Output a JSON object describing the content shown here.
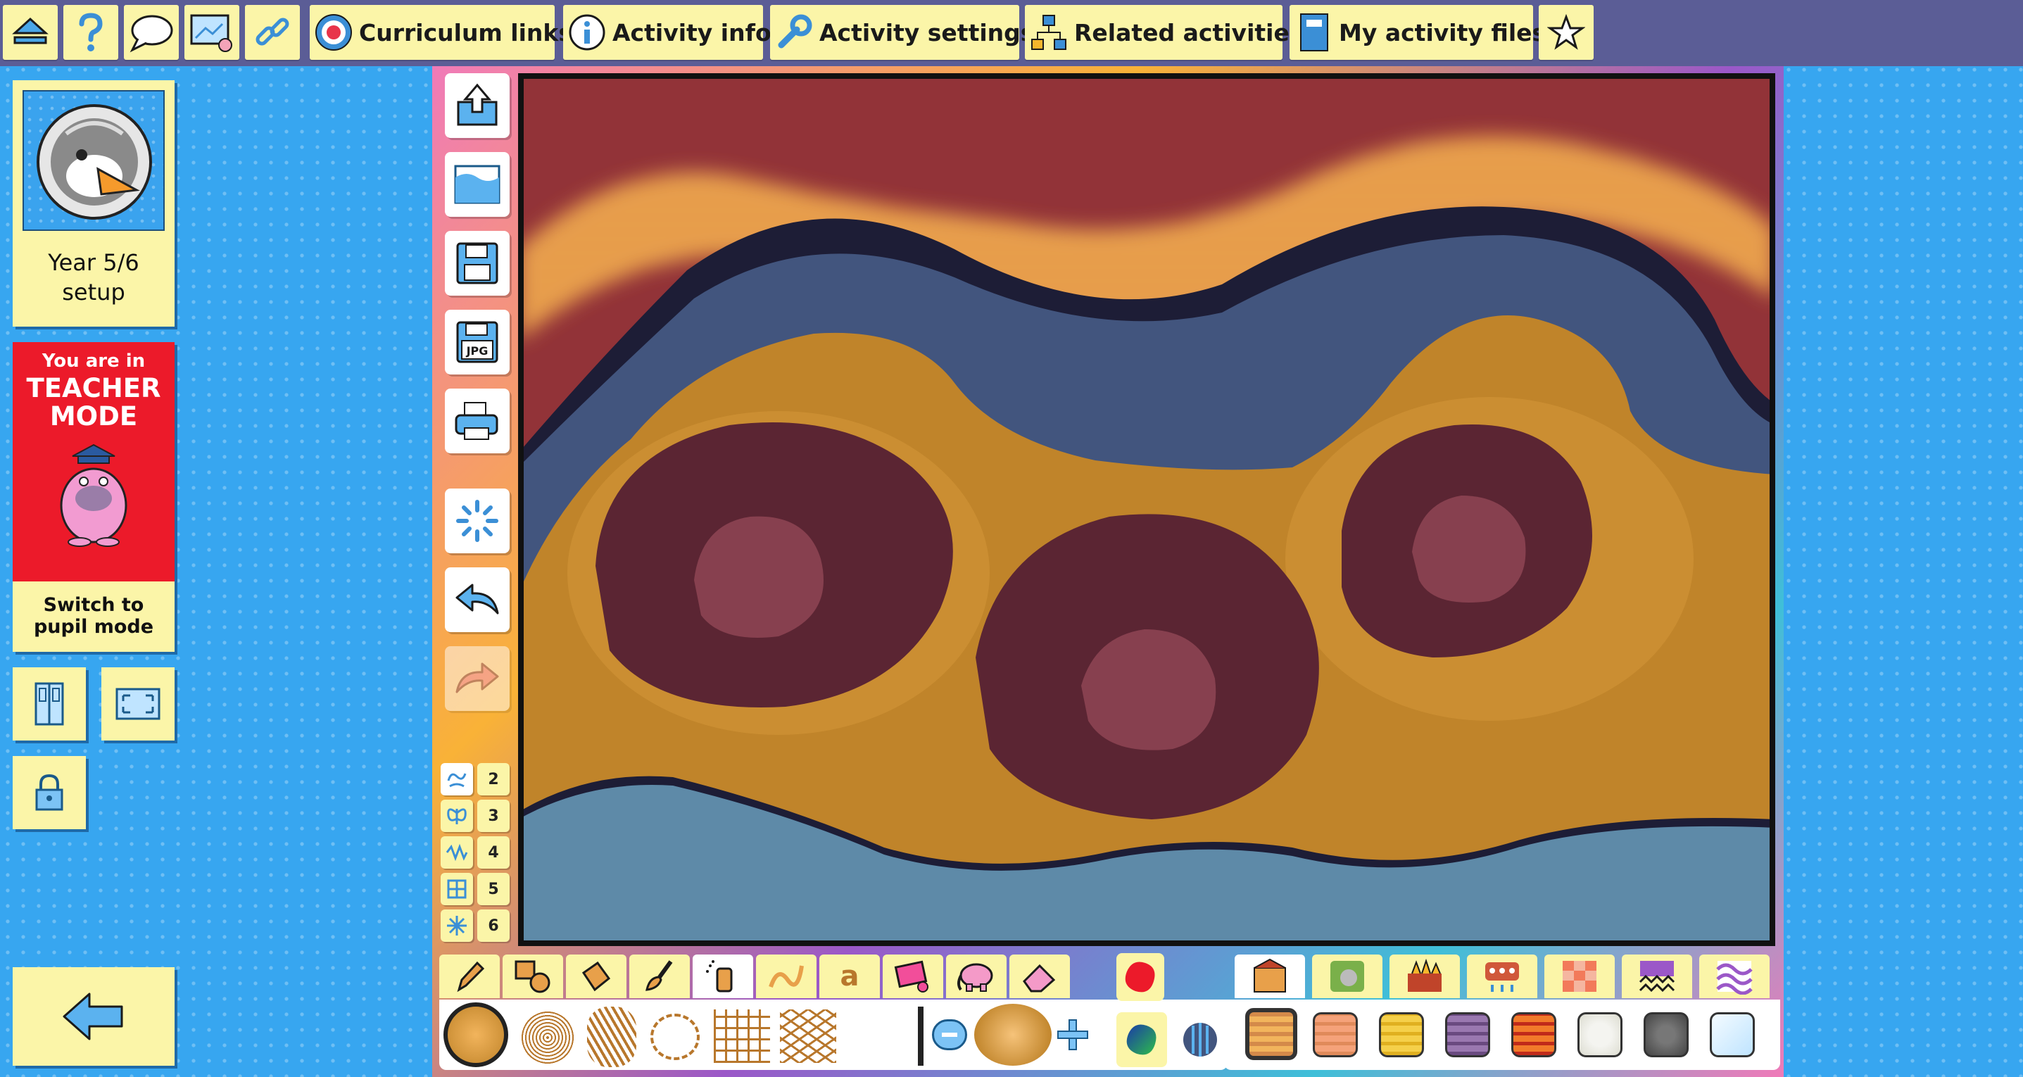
{
  "topbar": {
    "home_icon": "home-eject-icon",
    "help_icon": "question-icon",
    "chat_icon": "speech-bubble-icon",
    "present_icon": "present-screen-icon",
    "link_icon": "share-link-icon",
    "curriculum_links": "Curriculum links",
    "activity_info": "Activity info",
    "activity_settings": "Activity settings",
    "related_activities": "Related activities",
    "my_activity_files": "My activity files",
    "favourite_icon": "star-icon"
  },
  "left_panel": {
    "setup_line1": "Year 5/6",
    "setup_line2": "setup",
    "mode_small": "You are in",
    "mode_big_1": "TEACHER",
    "mode_big_2": "MODE",
    "switch_line1": "Switch to",
    "switch_line2": "pupil mode"
  },
  "editor": {
    "side_buttons": [
      "open-icon",
      "background-icon",
      "save-icon",
      "save-jpg-icon",
      "print-icon",
      "clear-icon",
      "undo-icon",
      "redo-icon"
    ],
    "jpg_label": "JPG",
    "mirror_numbers": [
      "2",
      "3",
      "4",
      "5",
      "6"
    ],
    "tool_tabs": [
      "pencil-tool",
      "shape-tool",
      "fill-tool",
      "brush-tool",
      "spray-tool",
      "pattern-tool",
      "text-tool",
      "stamp-tool",
      "clipart-tool",
      "eraser-tool"
    ],
    "text_tool_glyph": "a",
    "fill_tabs": [
      "brick-fills",
      "grass-fills",
      "fire-fills",
      "decor-fills",
      "tile-fills",
      "zigzag-fills",
      "wave-fills"
    ]
  },
  "colors": {
    "topbar": "#5b5d96",
    "button": "#fbf5a8",
    "teacher_red": "#ec1a2a",
    "background_blue": "#37a6f0"
  }
}
